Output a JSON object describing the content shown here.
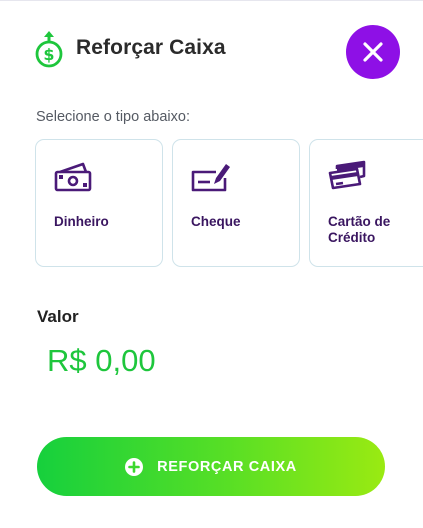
{
  "header": {
    "title": "Reforçar Caixa",
    "icon": "money-bag-icon",
    "close_icon": "close-icon",
    "close_color": "#8e10e6"
  },
  "selection": {
    "prompt": "Selecione o tipo abaixo:",
    "types": [
      {
        "label": "Dinheiro",
        "icon": "cash-icon"
      },
      {
        "label": "Cheque",
        "icon": "check-icon"
      },
      {
        "label": "Cartão de\nCrédito",
        "icon": "credit-card-icon"
      }
    ]
  },
  "amount": {
    "label": "Valor",
    "value": "R$ 0,00",
    "value_color": "#1ec63c"
  },
  "action": {
    "label": "REFORÇAR CAIXA",
    "icon": "plus-circle-icon"
  },
  "colors": {
    "accent": "#8e10e6",
    "icon_purple": "#4a1a78",
    "success": "#1ec63c"
  }
}
